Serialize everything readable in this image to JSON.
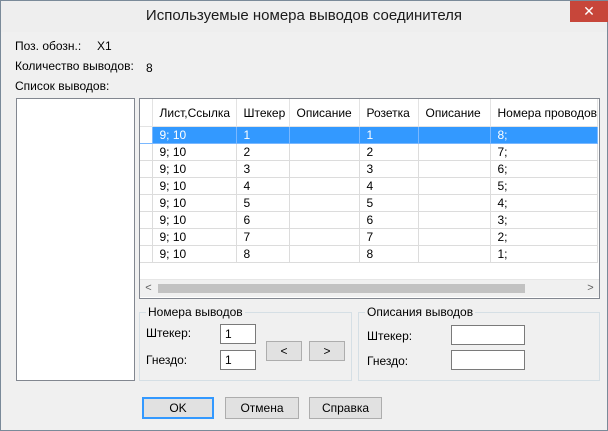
{
  "window": {
    "title": "Используемые номера выводов соединителя",
    "close_glyph": "✕"
  },
  "fields": {
    "pos_label": "Поз. обозн.:",
    "pos_value": "X1",
    "count_label": "Количество выводов:",
    "count_value": "8",
    "list_label": "Список выводов:"
  },
  "grid": {
    "columns": [
      "Лист,Ссылка",
      "Штекер",
      "Описание",
      "Розетка",
      "Описание",
      "Номера проводов"
    ],
    "rows": [
      [
        "9; 10",
        "1",
        "",
        "1",
        "",
        "8;"
      ],
      [
        "9; 10",
        "2",
        "",
        "2",
        "",
        "7;"
      ],
      [
        "9; 10",
        "3",
        "",
        "3",
        "",
        "6;"
      ],
      [
        "9; 10",
        "4",
        "",
        "4",
        "",
        "5;"
      ],
      [
        "9; 10",
        "5",
        "",
        "5",
        "",
        "4;"
      ],
      [
        "9; 10",
        "6",
        "",
        "6",
        "",
        "3;"
      ],
      [
        "9; 10",
        "7",
        "",
        "7",
        "",
        "2;"
      ],
      [
        "9; 10",
        "8",
        "",
        "8",
        "",
        "1;"
      ]
    ],
    "selected_row": 0,
    "scroll_left_glyph": "<",
    "scroll_right_glyph": ">"
  },
  "pin_numbers": {
    "caption": "Номера выводов",
    "plug_label": "Штекер:",
    "plug_value": "1",
    "socket_label": "Гнездо:",
    "socket_value": "1",
    "prev_label": "<",
    "next_label": ">"
  },
  "pin_descriptions": {
    "caption": "Описания выводов",
    "plug_label": "Штекер:",
    "plug_value": "",
    "socket_label": "Гнездо:",
    "socket_value": ""
  },
  "buttons": {
    "ok": "OK",
    "cancel": "Отмена",
    "help": "Справка"
  },
  "colors": {
    "selection": "#3399ff",
    "close_button": "#c7463a",
    "default_button_border": "#3399ff"
  }
}
